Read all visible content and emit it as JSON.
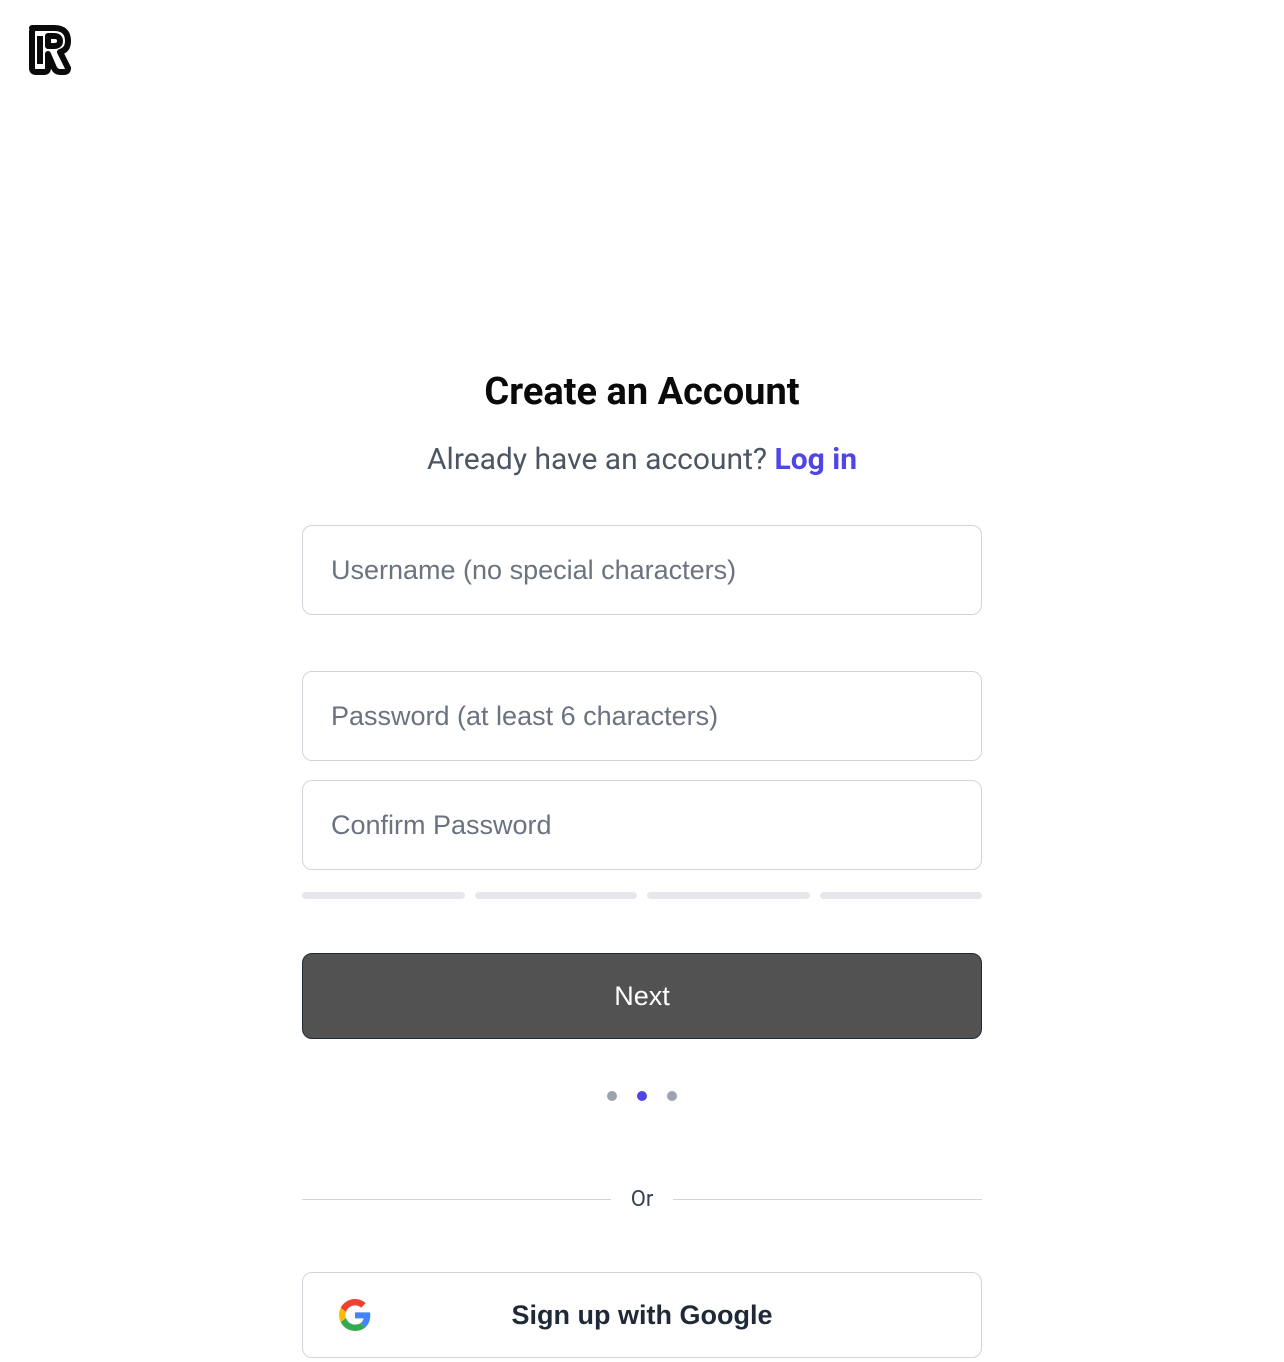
{
  "header": {
    "title": "Create an Account",
    "subtitle_prefix": "Already have an account? ",
    "login_link_text": "Log in"
  },
  "form": {
    "username": {
      "placeholder": "Username (no special characters)",
      "value": ""
    },
    "password": {
      "placeholder": "Password (at least 6 characters)",
      "value": ""
    },
    "confirm_password": {
      "placeholder": "Confirm Password",
      "value": ""
    },
    "next_button_label": "Next"
  },
  "progress": {
    "dots_total": 3,
    "active_dot_index": 1
  },
  "divider": {
    "text": "Or"
  },
  "oauth": {
    "google_label": "Sign up with Google"
  }
}
